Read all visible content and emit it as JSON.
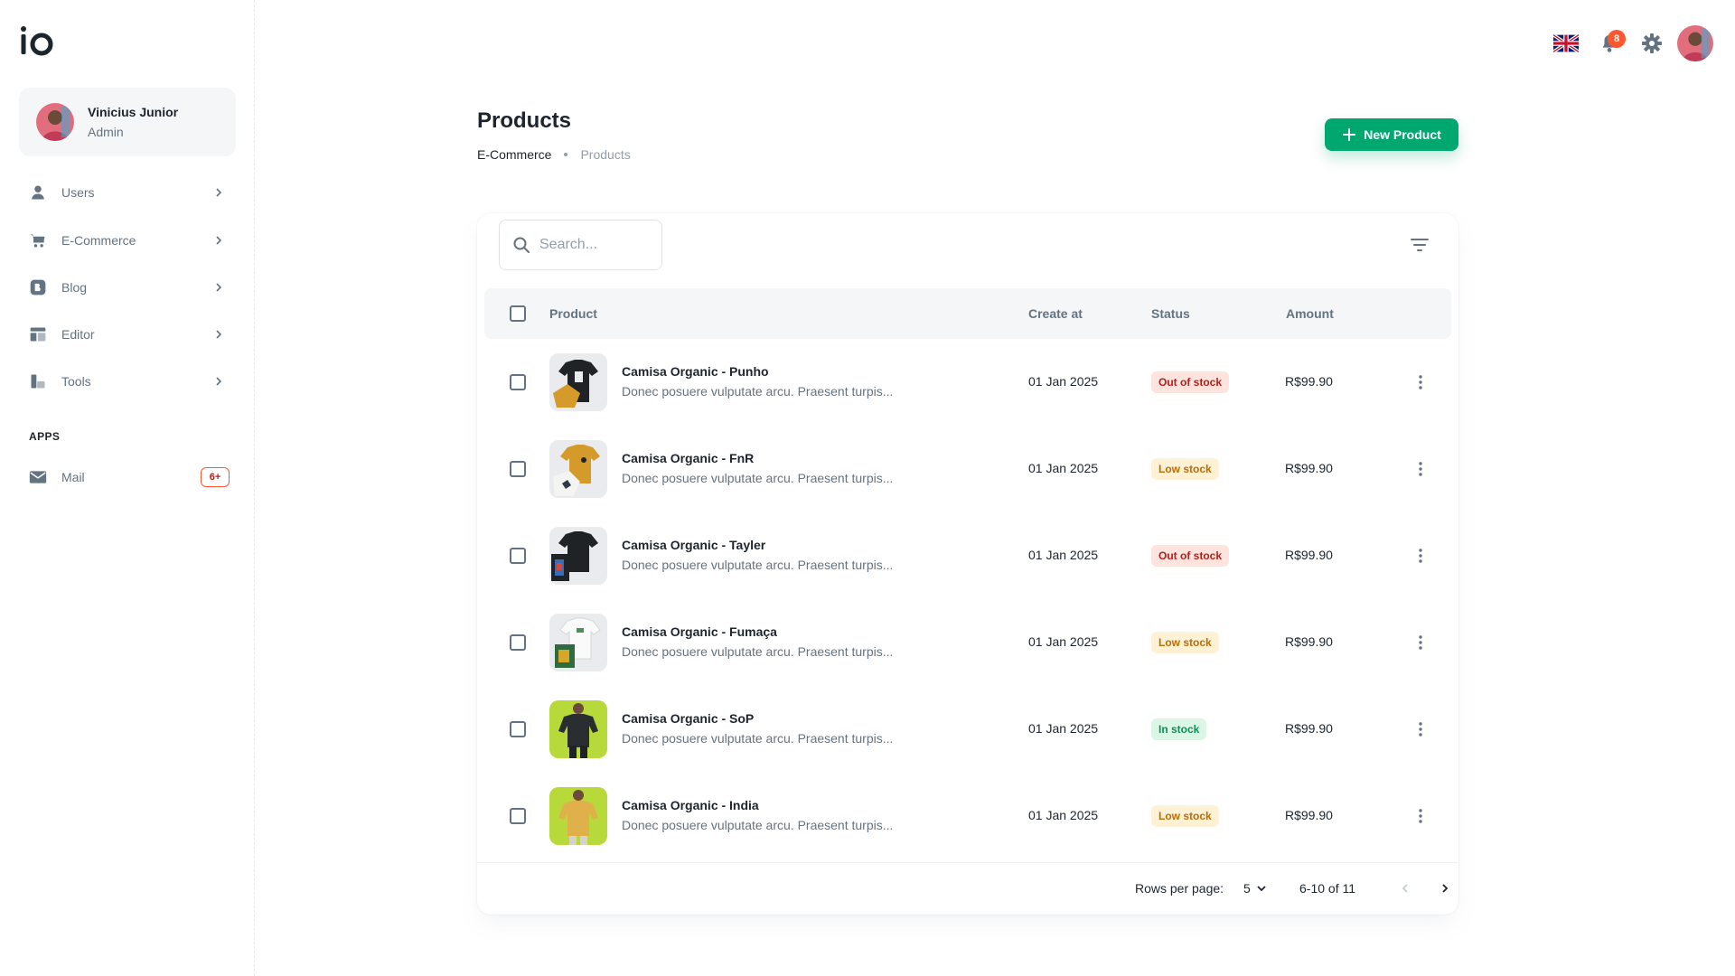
{
  "sidebar": {
    "account": {
      "name": "Vinicius Junior",
      "role": "Admin"
    },
    "items": [
      {
        "label": "Users",
        "icon": "user-icon"
      },
      {
        "label": "E-Commerce",
        "icon": "cart-icon"
      },
      {
        "label": "Blog",
        "icon": "blog-icon"
      },
      {
        "label": "Editor",
        "icon": "editor-icon"
      },
      {
        "label": "Tools",
        "icon": "tools-icon"
      }
    ],
    "apps_label": "APPS",
    "mail": {
      "label": "Mail",
      "badge": "6+"
    }
  },
  "header": {
    "language_icon": "uk-flag-icon",
    "notifications_count": "8"
  },
  "page": {
    "title": "Products",
    "breadcrumb": [
      "E-Commerce",
      "Products"
    ],
    "new_button_label": "New Product"
  },
  "search": {
    "placeholder": "Search..."
  },
  "table": {
    "columns": [
      "Product",
      "Create at",
      "Status",
      "Amount"
    ],
    "rows": [
      {
        "name": "Camisa Organic - Punho",
        "description": "Donec posuere vulputate arcu. Praesent turpis...",
        "created": "01 Jan 2025",
        "status": "Out of stock",
        "amount": "R$99.90"
      },
      {
        "name": "Camisa Organic - FnR",
        "description": "Donec posuere vulputate arcu. Praesent turpis...",
        "created": "01 Jan 2025",
        "status": "Low stock",
        "amount": "R$99.90"
      },
      {
        "name": "Camisa Organic - Tayler",
        "description": "Donec posuere vulputate arcu. Praesent turpis...",
        "created": "01 Jan 2025",
        "status": "Out of stock",
        "amount": "R$99.90"
      },
      {
        "name": "Camisa Organic - Fumaça",
        "description": "Donec posuere vulputate arcu. Praesent turpis...",
        "created": "01 Jan 2025",
        "status": "Low stock",
        "amount": "R$99.90"
      },
      {
        "name": "Camisa Organic - SoP",
        "description": "Donec posuere vulputate arcu. Praesent turpis...",
        "created": "01 Jan 2025",
        "status": "In stock",
        "amount": "R$99.90"
      },
      {
        "name": "Camisa Organic - India",
        "description": "Donec posuere vulputate arcu. Praesent turpis...",
        "created": "01 Jan 2025",
        "status": "Low stock",
        "amount": "R$99.90"
      }
    ]
  },
  "pagination": {
    "rows_per_page_label": "Rows per page:",
    "rows_per_page": "5",
    "range": "6-10 of 11"
  },
  "colors": {
    "primary": "#00a76f",
    "error": "#ff5630",
    "warning": "#ffab00",
    "success": "#22c55e"
  }
}
